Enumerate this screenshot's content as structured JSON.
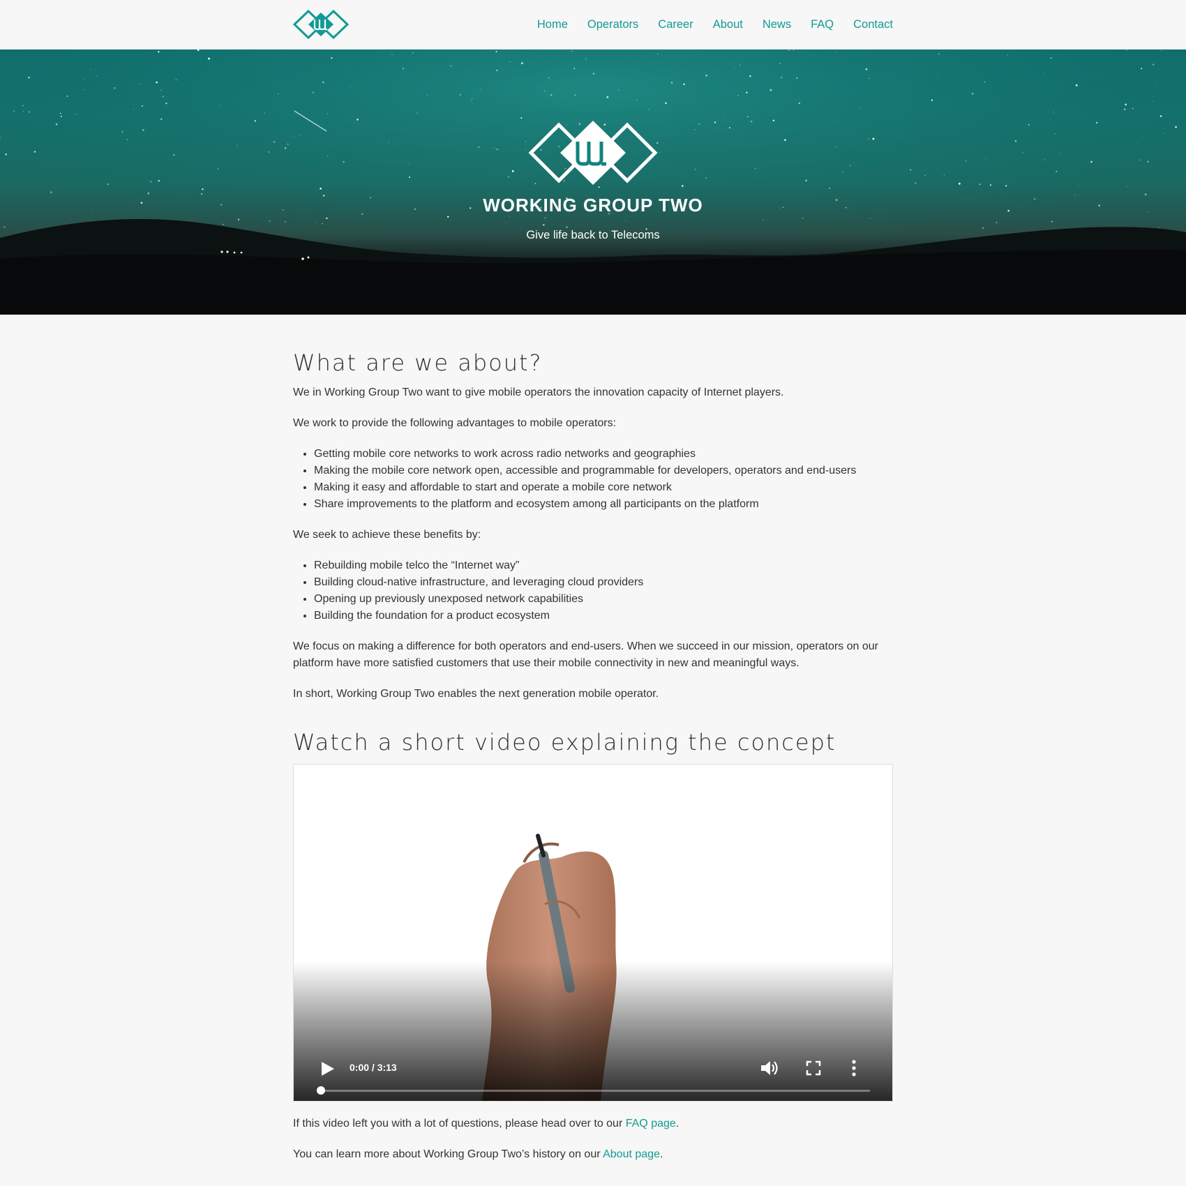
{
  "nav": {
    "logo_alt": "WG2 logo",
    "items": [
      {
        "label": "Home"
      },
      {
        "label": "Operators"
      },
      {
        "label": "Career"
      },
      {
        "label": "About"
      },
      {
        "label": "News"
      },
      {
        "label": "FAQ"
      },
      {
        "label": "Contact"
      }
    ]
  },
  "hero": {
    "logo_text": "WJ",
    "title": "WORKING GROUP TWO",
    "tagline": "Give life back to Telecoms"
  },
  "about": {
    "heading": "What are we about?",
    "intro": "We in Working Group Two want to give mobile operators the innovation capacity of Internet players.",
    "advantages_intro": "We work to provide the following advantages to mobile operators:",
    "advantages": [
      "Getting mobile core networks to work across radio networks and geographies",
      "Making the mobile core network open, accessible and programmable for developers, operators and end-users",
      "Making it easy and affordable to start and operate a mobile core network",
      "Share improvements to the platform and ecosystem among all participants on the platform"
    ],
    "benefits_intro": "We seek to achieve these benefits by:",
    "benefits": [
      "Rebuilding mobile telco the “Internet way”",
      "Building cloud-native infrastructure, and leveraging cloud providers",
      "Opening up previously unexposed network capabilities",
      "Building the foundation for a product ecosystem"
    ],
    "focus": "We focus on making a difference for both operators and end-users. When we succeed in our mission, operators on our platform have more satisfied customers that use their mobile connectivity in new and meaningful ways.",
    "summary": "In short, Working Group Two enables the next generation mobile operator."
  },
  "video_section": {
    "heading": "Watch a short video explaining the concept",
    "time": "0:00 / 3:13",
    "progress": 0
  },
  "footer_text": {
    "faq_before": "If this video left you with a lot of questions, please head over to our ",
    "faq_link": "FAQ page",
    "faq_after": ".",
    "about_before": "You can learn more about Working Group Two’s history on our ",
    "about_link": "About page",
    "about_after": "."
  },
  "colors": {
    "accent": "#139a94",
    "background": "#f6f7f6",
    "text": "#333333"
  }
}
